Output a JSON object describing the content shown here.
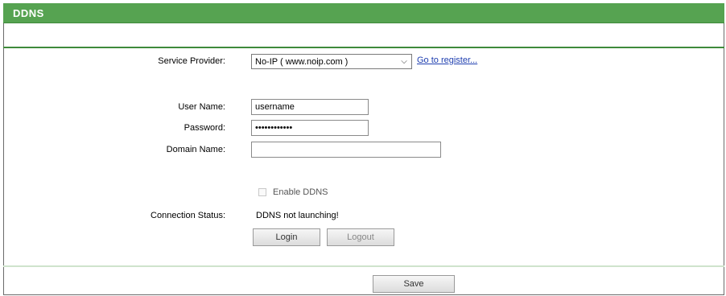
{
  "header": {
    "title": "DDNS"
  },
  "form": {
    "service_provider_label": "Service Provider:",
    "service_provider_value": "No-IP ( www.noip.com )",
    "go_register_link": "Go to register...",
    "username_label": "User Name:",
    "username_value": "username",
    "password_label": "Password:",
    "password_value": "••••••••••••",
    "domain_label": "Domain Name:",
    "domain_value": "",
    "enable_ddns_label": "Enable DDNS",
    "connection_status_label": "Connection Status:",
    "connection_status_value": "DDNS not launching!",
    "login_button": "Login",
    "logout_button": "Logout"
  },
  "footer": {
    "save_button": "Save"
  }
}
